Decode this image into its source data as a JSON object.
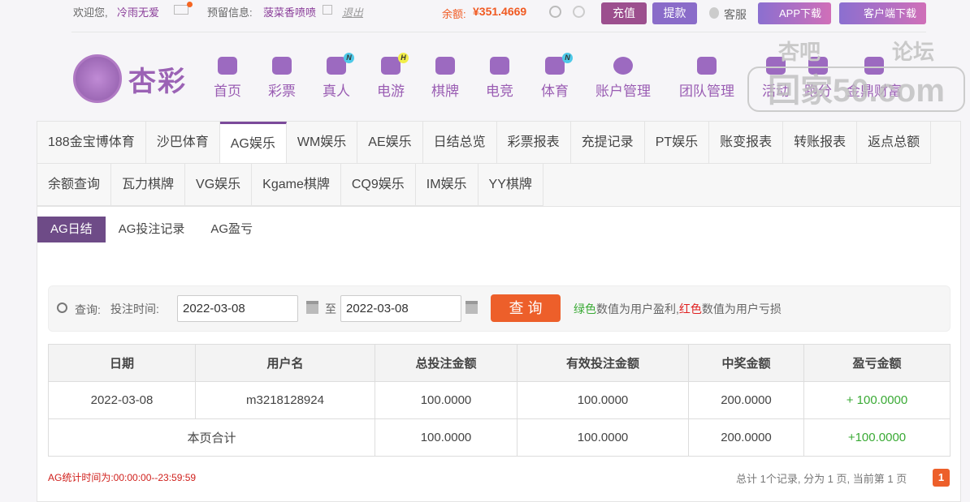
{
  "top": {
    "welcome": "欢迎您,",
    "username": "冷雨无爱",
    "reserved_label": "预留信息:",
    "reserved_value": "菠菜香喷喷",
    "logout": "退出",
    "balance_label": "余额:",
    "balance_value": "¥351.4669",
    "recharge": "充值",
    "withdraw": "提款",
    "service": "客服",
    "app_download": "APP下载",
    "client_download": "客户端下载"
  },
  "logo": {
    "text": "杏彩"
  },
  "nav": [
    {
      "label": "首页"
    },
    {
      "label": "彩票"
    },
    {
      "label": "真人",
      "badge": "N"
    },
    {
      "label": "电游",
      "badge": "H"
    },
    {
      "label": "棋牌"
    },
    {
      "label": "电竞"
    },
    {
      "label": "体育",
      "badge": "N"
    },
    {
      "label": "账户管理"
    },
    {
      "label": "团队管理"
    },
    {
      "label": "活动"
    },
    {
      "label": "跑分"
    },
    {
      "label": "金鼎财富"
    }
  ],
  "watermark": {
    "line1": "杏吧",
    "line2": "论坛",
    "line3": "回家50.com"
  },
  "tabs": [
    "188金宝博体育",
    "沙巴体育",
    "AG娱乐",
    "WM娱乐",
    "AE娱乐",
    "日结总览",
    "彩票报表",
    "充提记录",
    "PT娱乐",
    "账变报表",
    "转账报表",
    "返点总额",
    "余额查询",
    "瓦力棋牌",
    "VG娱乐",
    "Kgame棋牌",
    "CQ9娱乐",
    "IM娱乐",
    "YY棋牌"
  ],
  "subtabs": [
    "AG日结",
    "AG投注记录",
    "AG盈亏"
  ],
  "search": {
    "label": "查询:",
    "time_label": "投注时间:",
    "start": "2022-03-08",
    "to": "至",
    "end": "2022-03-08",
    "button": "查 询",
    "note_green": "绿色",
    "note_1": "数值为用户盈利,",
    "note_red": "红色",
    "note_2": "数值为用户亏损"
  },
  "table": {
    "headers": [
      "日期",
      "用户名",
      "总投注金额",
      "有效投注金额",
      "中奖金额",
      "盈亏金额"
    ],
    "row": [
      "2022-03-08",
      "m3218128924",
      "100.0000",
      "100.0000",
      "200.0000",
      "+ 100.0000"
    ],
    "total": [
      "本页合计",
      "100.0000",
      "100.0000",
      "200.0000",
      "+100.0000"
    ]
  },
  "footer": {
    "stat": "AG统计时间为:00:00:00--23:59:59",
    "pager": "总计 1个记录, 分为 1 页, 当前第 1 页",
    "page": "1"
  }
}
